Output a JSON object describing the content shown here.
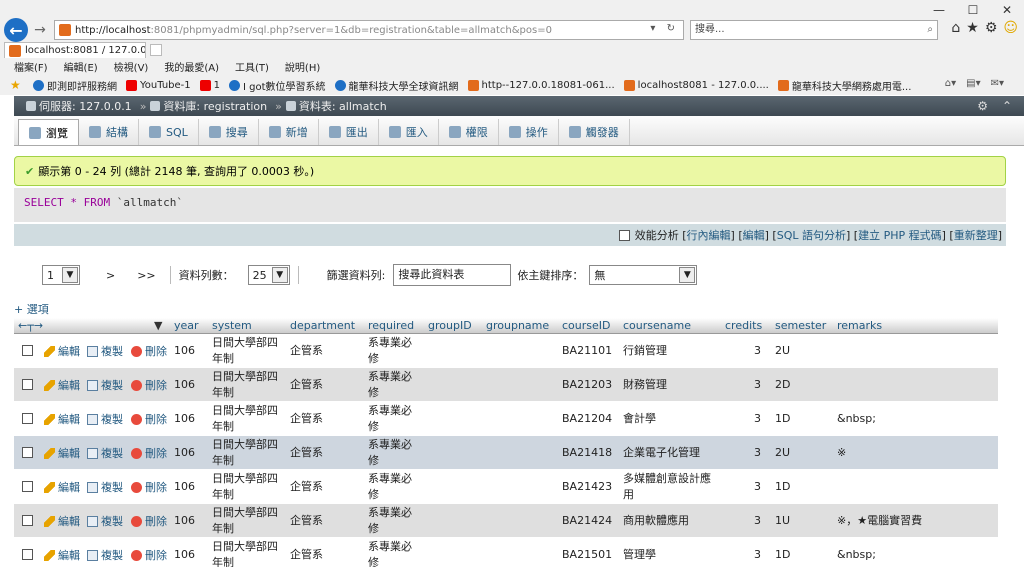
{
  "browser": {
    "address_host": "http://localhost",
    "address_rest": ":8081/phpmyadmin/sql.php?server=1&db=registration&table=allmatch&pos=0",
    "search_placeholder": "搜尋...",
    "tab_title": "localhost:8081 / 127.0.0.1...",
    "menu": [
      "檔案(F)",
      "編輯(E)",
      "檢視(V)",
      "我的最愛(A)",
      "工具(T)",
      "說明(H)"
    ],
    "favorites": [
      {
        "label": "即測即評服務網",
        "icon": "ie"
      },
      {
        "label": "YouTube-1",
        "icon": "yt"
      },
      {
        "label": "1",
        "icon": "yt"
      },
      {
        "label": "I got數位學習系統",
        "icon": "ie"
      },
      {
        "label": "龍華科技大學全球資訊網",
        "icon": "ie"
      },
      {
        "label": "http--127.0.0.18081-061...",
        "icon": "pma"
      },
      {
        "label": "localhost8081 - 127.0.0....",
        "icon": "pma"
      },
      {
        "label": "龍華科技大學網務處用電...",
        "icon": "pma"
      }
    ]
  },
  "pma": {
    "breadcrumb": {
      "server": "伺服器: 127.0.0.1",
      "database": "資料庫: registration",
      "table": "資料表: allmatch"
    },
    "tabs": [
      "瀏覽",
      "結構",
      "SQL",
      "搜尋",
      "新增",
      "匯出",
      "匯入",
      "權限",
      "操作",
      "觸發器"
    ],
    "success_message": "顯示第 0 - 24 列 (總計 2148 筆, 查詢用了 0.0003 秒。)",
    "sql": {
      "kw1": "SELECT",
      "star": "*",
      "kw2": "FROM",
      "table": "`allmatch`"
    },
    "links": {
      "profiling": "效能分析",
      "inline_edit": "行內編輯",
      "edit": "編輯",
      "explain": "SQL 語句分析",
      "create_php": "建立 PHP 程式碼",
      "refresh": "重新整理"
    },
    "nav": {
      "page": "1",
      "next": ">",
      "last": ">>",
      "rows_label": "資料列數：",
      "rows_value": "25",
      "filter_label": "篩選資料列:",
      "filter_placeholder": "搜尋此資料表",
      "sort_label": "依主鍵排序：",
      "sort_value": "無"
    },
    "options_label": "+ 選項",
    "columns": [
      "year",
      "system",
      "department",
      "required",
      "groupID",
      "groupname",
      "courseID",
      "coursename",
      "credits",
      "semester",
      "remarks"
    ],
    "action_labels": {
      "edit": "編輯",
      "copy": "複製",
      "delete": "刪除"
    },
    "rows": [
      {
        "year": "106",
        "system": "日間大學部四年制",
        "department": "企管系",
        "required": "系專業必修",
        "groupID": "",
        "groupname": "",
        "courseID": "BA21101",
        "coursename": "行銷管理",
        "credits": "3",
        "semester": "2U",
        "remarks": ""
      },
      {
        "year": "106",
        "system": "日間大學部四年制",
        "department": "企管系",
        "required": "系專業必修",
        "groupID": "",
        "groupname": "",
        "courseID": "BA21203",
        "coursename": "財務管理",
        "credits": "3",
        "semester": "2D",
        "remarks": ""
      },
      {
        "year": "106",
        "system": "日間大學部四年制",
        "department": "企管系",
        "required": "系專業必修",
        "groupID": "",
        "groupname": "",
        "courseID": "BA21204",
        "coursename": "會計學",
        "credits": "3",
        "semester": "1D",
        "remarks": "&nbsp;"
      },
      {
        "year": "106",
        "system": "日間大學部四年制",
        "department": "企管系",
        "required": "系專業必修",
        "groupID": "",
        "groupname": "",
        "courseID": "BA21418",
        "coursename": "企業電子化管理",
        "credits": "3",
        "semester": "2U",
        "remarks": "※"
      },
      {
        "year": "106",
        "system": "日間大學部四年制",
        "department": "企管系",
        "required": "系專業必修",
        "groupID": "",
        "groupname": "",
        "courseID": "BA21423",
        "coursename": "多媒體創意設計應用",
        "credits": "3",
        "semester": "1D",
        "remarks": ""
      },
      {
        "year": "106",
        "system": "日間大學部四年制",
        "department": "企管系",
        "required": "系專業必修",
        "groupID": "",
        "groupname": "",
        "courseID": "BA21424",
        "coursename": "商用軟體應用",
        "credits": "3",
        "semester": "1U",
        "remarks": "※，★電腦實習費"
      },
      {
        "year": "106",
        "system": "日間大學部四年制",
        "department": "企管系",
        "required": "系專業必修",
        "groupID": "",
        "groupname": "",
        "courseID": "BA21501",
        "coursename": "管理學",
        "credits": "3",
        "semester": "1D",
        "remarks": "&nbsp;"
      }
    ]
  }
}
